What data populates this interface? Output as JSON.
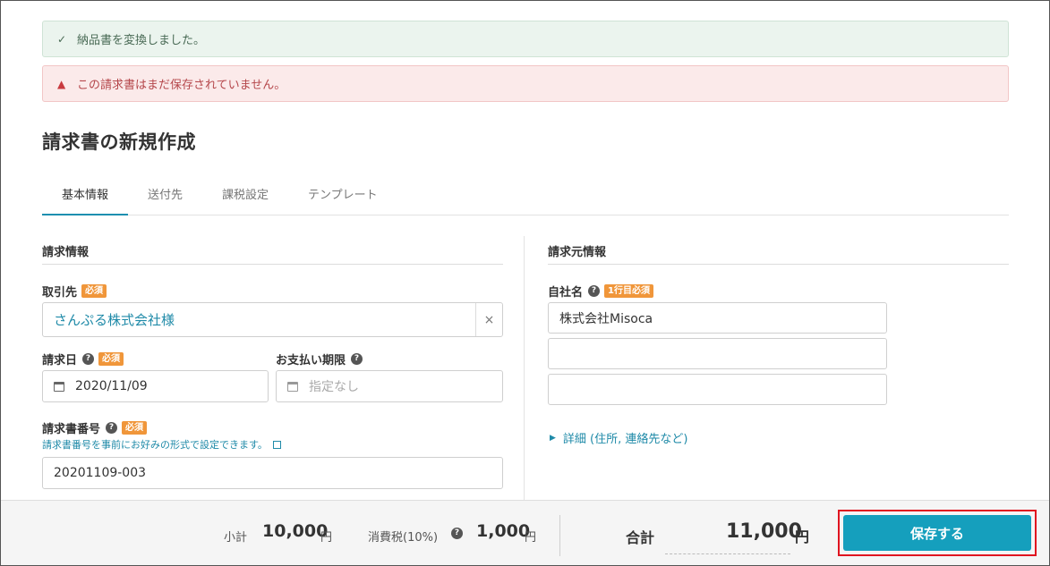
{
  "alerts": {
    "success": {
      "icon": "check-icon",
      "text": "納品書を変換しました。"
    },
    "danger": {
      "icon": "warning-icon",
      "text": "この請求書はまだ保存されていません。"
    }
  },
  "page": {
    "title": "請求書の新規作成"
  },
  "tabs": [
    {
      "label": "基本情報",
      "active": true
    },
    {
      "label": "送付先",
      "active": false
    },
    {
      "label": "課税設定",
      "active": false
    },
    {
      "label": "テンプレート",
      "active": false
    }
  ],
  "billing": {
    "heading": "請求情報",
    "client": {
      "label": "取引先",
      "required": "必須",
      "value": "さんぷる株式会社様",
      "clear": "×"
    },
    "invoice_date": {
      "label": "請求日",
      "required": "必須",
      "value": "2020/11/09"
    },
    "due_date": {
      "label": "お支払い期限",
      "placeholder": "指定なし"
    },
    "invoice_number": {
      "label": "請求書番号",
      "required": "必須",
      "hint": "請求書番号を事前にお好みの形式で設定できます。",
      "value": "20201109-003"
    }
  },
  "issuer": {
    "heading": "請求元情報",
    "company": {
      "label": "自社名",
      "required": "1行目必須",
      "line1": "株式会社Misoca",
      "line2": "",
      "line3": ""
    },
    "details_link": "詳細 (住所, 連絡先など)"
  },
  "footer": {
    "subtotal_label": "小計",
    "subtotal_value": "10,000",
    "tax_label": "消費税(10%)",
    "tax_value": "1,000",
    "currency": "円",
    "total_label": "合計",
    "total_value": "11,000",
    "save_label": "保存する"
  },
  "colors": {
    "accent": "#159fbd",
    "link": "#1f8aa8",
    "required_badge": "#f0963a",
    "highlight": "#e0141f"
  }
}
